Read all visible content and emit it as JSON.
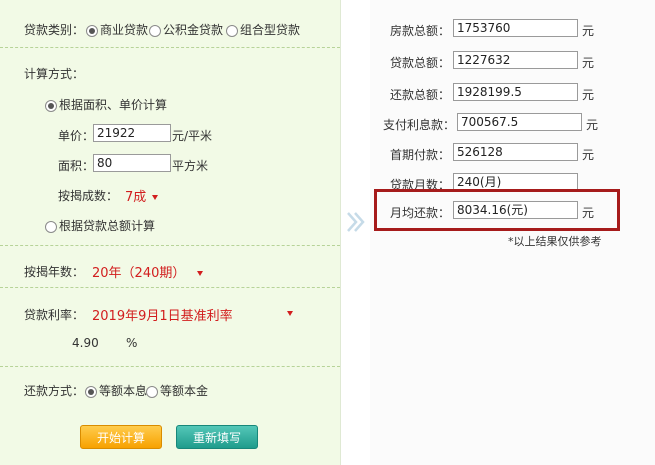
{
  "left": {
    "loan_type": {
      "label": "贷款类别：",
      "options": [
        "商业贷款",
        "公积金贷款",
        "组合型贷款"
      ],
      "selected": 0
    },
    "calc_method": {
      "label": "计算方式：",
      "option_area": "根据面积、单价计算",
      "unit_price_label": "单价：",
      "unit_price_value": "21922",
      "unit_price_unit": "元/平米",
      "area_label": "面积：",
      "area_value": "80",
      "area_unit": "平方米",
      "ratio_label": "按揭成数：",
      "ratio_value": "7成",
      "option_total": "根据贷款总额计算"
    },
    "years": {
      "label": "按揭年数：",
      "value": "20年（240期）"
    },
    "rate": {
      "label": "贷款利率：",
      "value": "2019年9月1日基准利率",
      "number": "4.90",
      "unit": "%"
    },
    "repay": {
      "label": "还款方式：",
      "options": [
        "等额本息",
        "等额本金"
      ],
      "selected": 0
    },
    "buttons": {
      "calculate": "开始计算",
      "reset": "重新填写"
    }
  },
  "right": {
    "rows": [
      {
        "label": "房款总额：",
        "value": "1753760",
        "unit": "元"
      },
      {
        "label": "贷款总额：",
        "value": "1227632",
        "unit": "元"
      },
      {
        "label": "还款总额：",
        "value": "1928199.5",
        "unit": "元"
      },
      {
        "label": "支付利息款：",
        "value": "700567.5",
        "unit": "元"
      },
      {
        "label": "首期付款：",
        "value": "526128",
        "unit": "元"
      },
      {
        "label": "贷款月数：",
        "value": "240(月)",
        "unit": ""
      },
      {
        "label": "月均还款：",
        "value": "8034.16(元)",
        "unit": "元"
      }
    ],
    "note": "*以上结果仅供参考"
  },
  "colors": {
    "left_bg": "#f2fae6",
    "accent_red": "#d21e1e",
    "highlight": "#a61b1b",
    "button_orange": "#f7a100",
    "button_teal": "#1f9c8c"
  }
}
